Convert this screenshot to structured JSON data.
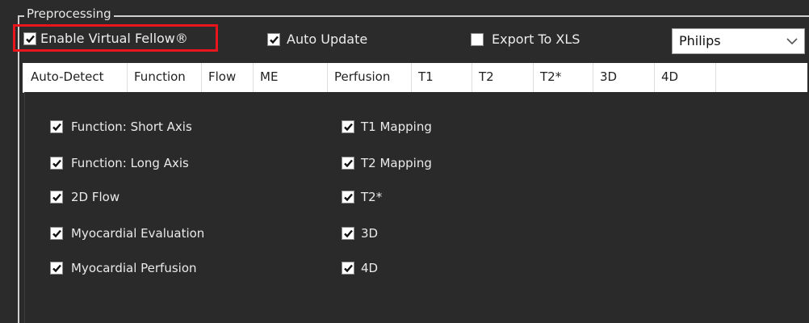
{
  "group": {
    "title": "Preprocessing"
  },
  "top_options": [
    {
      "label": "Enable Virtual Fellow®",
      "checked": true
    },
    {
      "label": "Auto Update",
      "checked": true
    },
    {
      "label": "Export To XLS",
      "checked": false
    }
  ],
  "vendor_select": {
    "value": "Philips"
  },
  "tabs": [
    {
      "label": "Auto-Detect",
      "active": true
    },
    {
      "label": "Function",
      "active": false
    },
    {
      "label": "Flow",
      "active": false
    },
    {
      "label": "ME",
      "active": false
    },
    {
      "label": "Perfusion",
      "active": false
    },
    {
      "label": "T1",
      "active": false
    },
    {
      "label": "T2",
      "active": false
    },
    {
      "label": "T2*",
      "active": false
    },
    {
      "label": "3D",
      "active": false
    },
    {
      "label": "4D",
      "active": false
    }
  ],
  "auto_detect": {
    "left_column": [
      {
        "label": "Function: Short Axis",
        "checked": true
      },
      {
        "label": "Function: Long Axis",
        "checked": true
      },
      {
        "label": "2D Flow",
        "checked": true
      },
      {
        "label": "Myocardial Evaluation",
        "checked": true
      },
      {
        "label": "Myocardial Perfusion",
        "checked": true
      }
    ],
    "right_column": [
      {
        "label": "T1 Mapping",
        "checked": true
      },
      {
        "label": "T2 Mapping",
        "checked": true
      },
      {
        "label": "T2*",
        "checked": true
      },
      {
        "label": "3D",
        "checked": true
      },
      {
        "label": "4D",
        "checked": true
      }
    ]
  },
  "colors": {
    "highlight": "#e8151c",
    "panel_background": "#2a2a2a"
  }
}
